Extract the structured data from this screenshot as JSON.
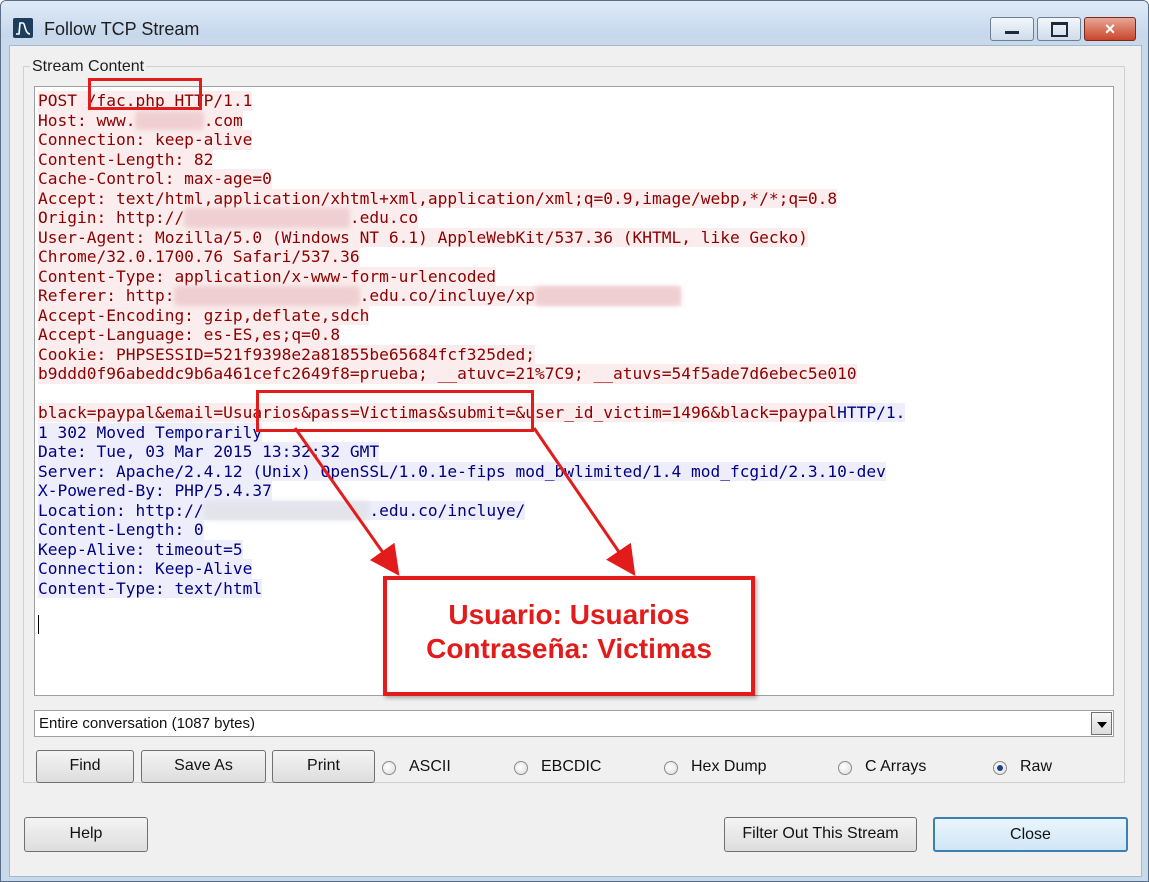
{
  "window": {
    "title": "Follow TCP Stream",
    "minimize_icon": "minimize-icon",
    "maximize_icon": "maximize-icon",
    "close_glyph": "×"
  },
  "group_label": "Stream Content",
  "stream": {
    "request": {
      "line1_method": "POST ",
      "line1_path": "/fac.php",
      "line1_proto": " HTTP/1.1",
      "host_a": "Host: www.",
      "host_b": ".com",
      "connection": "Connection: keep-alive",
      "content_length": "Content-Length: 82",
      "cache_control": "Cache-Control: max-age=0",
      "accept": "Accept: text/html,application/xhtml+xml,application/xml;q=0.9,image/webp,*/*;q=0.8",
      "origin_a": "Origin: http://",
      "origin_b": ".edu.co",
      "user_agent": "User-Agent: Mozilla/5.0 (Windows NT 6.1) AppleWebKit/537.36 (KHTML, like Gecko)",
      "user_agent_2": "Chrome/32.0.1700.76 Safari/537.36",
      "content_type": "Content-Type: application/x-www-form-urlencoded",
      "referer_a": "Referer: http:",
      "referer_b": ".edu.co/incluye/xp",
      "accept_encoding": "Accept-Encoding: gzip,deflate,sdch",
      "accept_language": "Accept-Language: es-ES,es;q=0.8",
      "cookie": "Cookie: PHPSESSID=521f9398e2a81855be65684fcf325ded;",
      "cookie_2": "b9ddd0f96abeddc9b6a461cefc2649f8=prueba; __atuvc=21%7C9; __atuvs=54f5ade7d6ebec5e010",
      "body_a": "black=paypal&email=",
      "body_b": "Usuarios&pass=Victimas",
      "body_c": "&submit=&user_id_victim=1496&black=paypal"
    },
    "response": {
      "status_a": "HTTP/1.",
      "status_b": "1 302 Moved Temporarily",
      "date": "Date: Tue, 03 Mar 2015 13:32:32 GMT",
      "server": "Server: Apache/2.4.12 (Unix) OpenSSL/1.0.1e-fips mod_bwlimited/1.4 mod_fcgid/2.3.10-dev",
      "powered_by": "X-Powered-By: PHP/5.4.37",
      "location_a": "Location: http://",
      "location_b": ".edu.co/incluye/",
      "content_length": "Content-Length: 0",
      "keep_alive": "Keep-Alive: timeout=5",
      "connection": "Connection: Keep-Alive",
      "content_type": "Content-Type: text/html"
    }
  },
  "annotation": {
    "line1": "Usuario: Usuarios",
    "line2": "Contraseña: Victimas",
    "color": "#e21b1b"
  },
  "conversation_select": {
    "value": "Entire conversation (1087 bytes)"
  },
  "buttons": {
    "find": "Find",
    "save_as": "Save As",
    "print": "Print",
    "help": "Help",
    "filter": "Filter Out This Stream",
    "close": "Close"
  },
  "formats": {
    "ascii": "ASCII",
    "ebcdic": "EBCDIC",
    "hex_dump": "Hex Dump",
    "c_arrays": "C Arrays",
    "raw": "Raw",
    "selected": "Raw"
  },
  "colors": {
    "request_text": "#8b0000",
    "request_bg": "#fbeded",
    "response_text": "#000080",
    "response_bg": "#ededfb"
  }
}
